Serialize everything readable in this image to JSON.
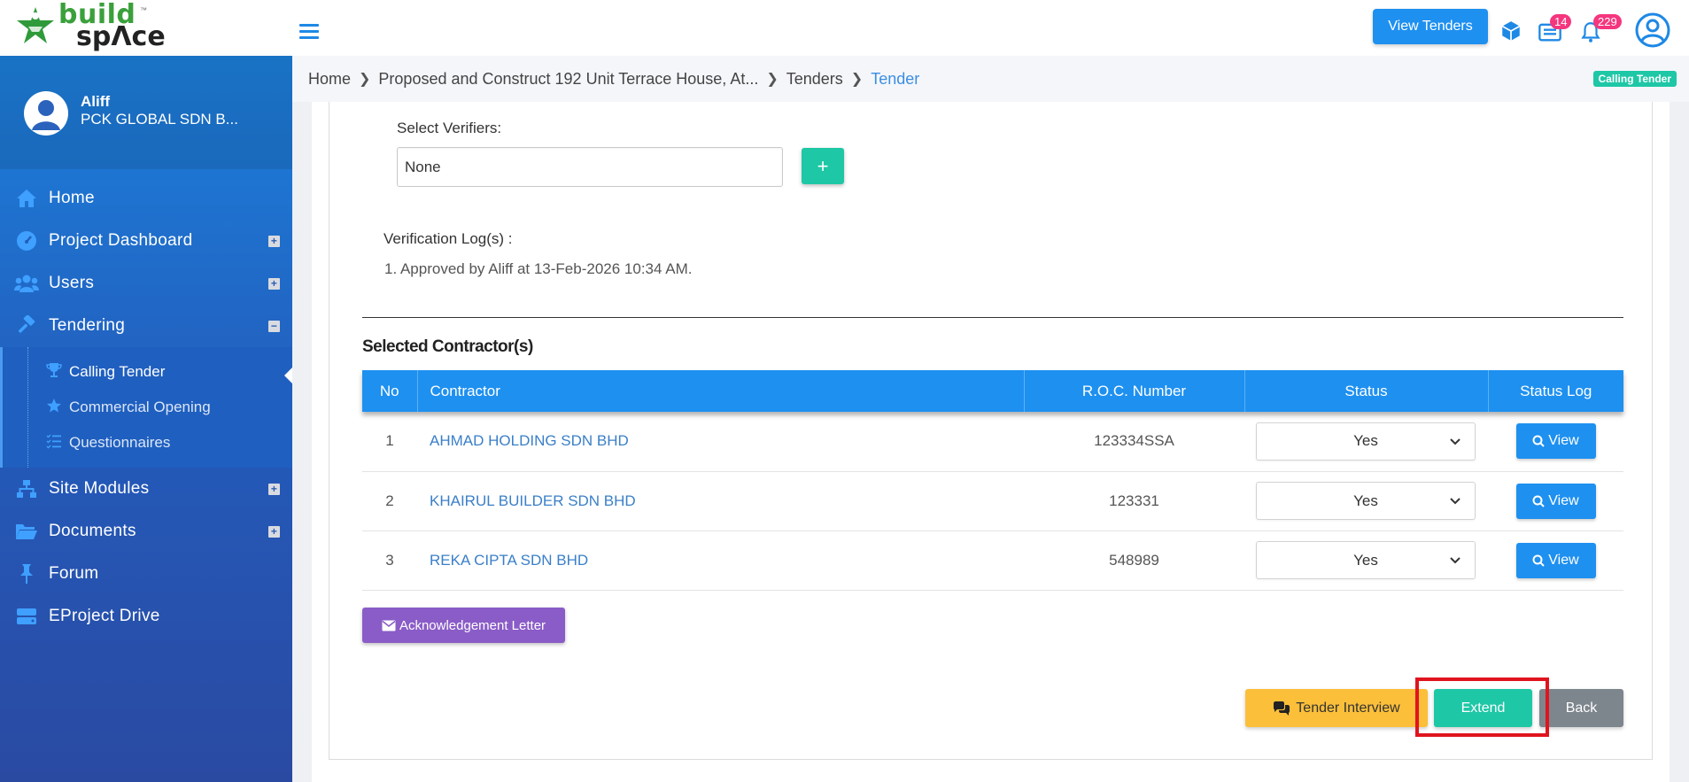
{
  "brand": {
    "line1": "build",
    "line2": "spΛce",
    "tm": "™"
  },
  "header": {
    "view_tenders_label": "View Tenders",
    "messages_badge": "14",
    "notifications_badge": "229"
  },
  "user": {
    "name": "Aliff",
    "company": "PCK GLOBAL SDN B..."
  },
  "sidebar": {
    "items": [
      {
        "label": "Home",
        "icon": "home-icon"
      },
      {
        "label": "Project Dashboard",
        "icon": "dashboard-icon",
        "expand": "+"
      },
      {
        "label": "Users",
        "icon": "users-icon",
        "expand": "+"
      },
      {
        "label": "Tendering",
        "icon": "gavel-icon",
        "expand": "−"
      },
      {
        "label": "Site Modules",
        "icon": "sitemap-icon",
        "expand": "+"
      },
      {
        "label": "Documents",
        "icon": "folder-icon",
        "expand": "+"
      },
      {
        "label": "Forum",
        "icon": "pin-icon"
      },
      {
        "label": "EProject Drive",
        "icon": "drive-icon"
      }
    ],
    "tendering_sub": [
      {
        "label": "Calling Tender",
        "icon": "trophy-icon"
      },
      {
        "label": "Commercial Opening",
        "icon": "star-icon"
      },
      {
        "label": "Questionnaires",
        "icon": "checklist-icon"
      }
    ]
  },
  "breadcrumb": {
    "items": [
      "Home",
      "Proposed and Construct 192 Unit Terrace House, At...",
      "Tenders",
      "Tender"
    ],
    "state_badge": "Calling Tender"
  },
  "verifiers": {
    "label": "Select Verifiers:",
    "value": "None",
    "add_label": "+"
  },
  "verification_log": {
    "title": "Verification Log(s) :",
    "items": [
      "1. Approved by Aliff at 13-Feb-2026 10:34 AM."
    ]
  },
  "contractors": {
    "title": "Selected Contractor(s)",
    "columns": [
      "No",
      "Contractor",
      "R.O.C. Number",
      "Status",
      "Status Log"
    ],
    "rows": [
      {
        "no": "1",
        "name": "AHMAD HOLDING SDN BHD",
        "roc": "123334SSA",
        "status": "Yes",
        "action": "View"
      },
      {
        "no": "2",
        "name": "KHAIRUL BUILDER SDN BHD",
        "roc": "123331",
        "status": "Yes",
        "action": "View"
      },
      {
        "no": "3",
        "name": "REKA CIPTA SDN BHD",
        "roc": "548989",
        "status": "Yes",
        "action": "View"
      }
    ]
  },
  "actions": {
    "acknowledgement": "Acknowledgement Letter",
    "tender_interview": "Tender Interview",
    "extend": "Extend",
    "back": "Back"
  },
  "colors": {
    "primary": "#1e90f0",
    "teal": "#1ec7a6",
    "purple": "#8a5cc7",
    "amber": "#fcbf3a",
    "grey": "#7d858d",
    "highlight": "#e0141e"
  }
}
